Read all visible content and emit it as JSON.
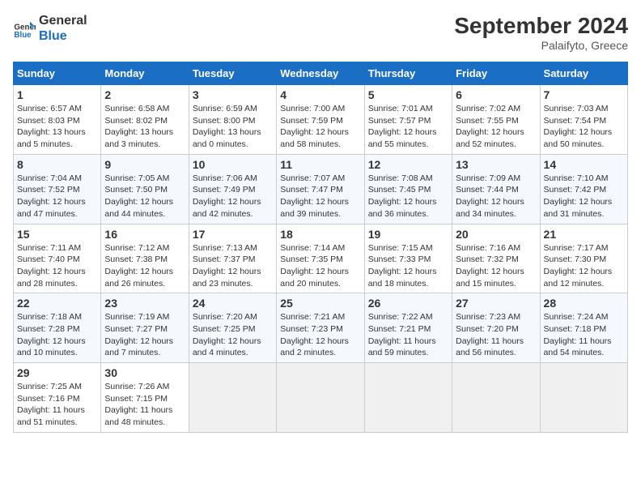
{
  "logo": {
    "line1": "General",
    "line2": "Blue"
  },
  "title": "September 2024",
  "subtitle": "Palaifyto, Greece",
  "headers": [
    "Sunday",
    "Monday",
    "Tuesday",
    "Wednesday",
    "Thursday",
    "Friday",
    "Saturday"
  ],
  "weeks": [
    [
      {
        "day": "1",
        "info": "Sunrise: 6:57 AM\nSunset: 8:03 PM\nDaylight: 13 hours\nand 5 minutes."
      },
      {
        "day": "2",
        "info": "Sunrise: 6:58 AM\nSunset: 8:02 PM\nDaylight: 13 hours\nand 3 minutes."
      },
      {
        "day": "3",
        "info": "Sunrise: 6:59 AM\nSunset: 8:00 PM\nDaylight: 13 hours\nand 0 minutes."
      },
      {
        "day": "4",
        "info": "Sunrise: 7:00 AM\nSunset: 7:59 PM\nDaylight: 12 hours\nand 58 minutes."
      },
      {
        "day": "5",
        "info": "Sunrise: 7:01 AM\nSunset: 7:57 PM\nDaylight: 12 hours\nand 55 minutes."
      },
      {
        "day": "6",
        "info": "Sunrise: 7:02 AM\nSunset: 7:55 PM\nDaylight: 12 hours\nand 52 minutes."
      },
      {
        "day": "7",
        "info": "Sunrise: 7:03 AM\nSunset: 7:54 PM\nDaylight: 12 hours\nand 50 minutes."
      }
    ],
    [
      {
        "day": "8",
        "info": "Sunrise: 7:04 AM\nSunset: 7:52 PM\nDaylight: 12 hours\nand 47 minutes."
      },
      {
        "day": "9",
        "info": "Sunrise: 7:05 AM\nSunset: 7:50 PM\nDaylight: 12 hours\nand 44 minutes."
      },
      {
        "day": "10",
        "info": "Sunrise: 7:06 AM\nSunset: 7:49 PM\nDaylight: 12 hours\nand 42 minutes."
      },
      {
        "day": "11",
        "info": "Sunrise: 7:07 AM\nSunset: 7:47 PM\nDaylight: 12 hours\nand 39 minutes."
      },
      {
        "day": "12",
        "info": "Sunrise: 7:08 AM\nSunset: 7:45 PM\nDaylight: 12 hours\nand 36 minutes."
      },
      {
        "day": "13",
        "info": "Sunrise: 7:09 AM\nSunset: 7:44 PM\nDaylight: 12 hours\nand 34 minutes."
      },
      {
        "day": "14",
        "info": "Sunrise: 7:10 AM\nSunset: 7:42 PM\nDaylight: 12 hours\nand 31 minutes."
      }
    ],
    [
      {
        "day": "15",
        "info": "Sunrise: 7:11 AM\nSunset: 7:40 PM\nDaylight: 12 hours\nand 28 minutes."
      },
      {
        "day": "16",
        "info": "Sunrise: 7:12 AM\nSunset: 7:38 PM\nDaylight: 12 hours\nand 26 minutes."
      },
      {
        "day": "17",
        "info": "Sunrise: 7:13 AM\nSunset: 7:37 PM\nDaylight: 12 hours\nand 23 minutes."
      },
      {
        "day": "18",
        "info": "Sunrise: 7:14 AM\nSunset: 7:35 PM\nDaylight: 12 hours\nand 20 minutes."
      },
      {
        "day": "19",
        "info": "Sunrise: 7:15 AM\nSunset: 7:33 PM\nDaylight: 12 hours\nand 18 minutes."
      },
      {
        "day": "20",
        "info": "Sunrise: 7:16 AM\nSunset: 7:32 PM\nDaylight: 12 hours\nand 15 minutes."
      },
      {
        "day": "21",
        "info": "Sunrise: 7:17 AM\nSunset: 7:30 PM\nDaylight: 12 hours\nand 12 minutes."
      }
    ],
    [
      {
        "day": "22",
        "info": "Sunrise: 7:18 AM\nSunset: 7:28 PM\nDaylight: 12 hours\nand 10 minutes."
      },
      {
        "day": "23",
        "info": "Sunrise: 7:19 AM\nSunset: 7:27 PM\nDaylight: 12 hours\nand 7 minutes."
      },
      {
        "day": "24",
        "info": "Sunrise: 7:20 AM\nSunset: 7:25 PM\nDaylight: 12 hours\nand 4 minutes."
      },
      {
        "day": "25",
        "info": "Sunrise: 7:21 AM\nSunset: 7:23 PM\nDaylight: 12 hours\nand 2 minutes."
      },
      {
        "day": "26",
        "info": "Sunrise: 7:22 AM\nSunset: 7:21 PM\nDaylight: 11 hours\nand 59 minutes."
      },
      {
        "day": "27",
        "info": "Sunrise: 7:23 AM\nSunset: 7:20 PM\nDaylight: 11 hours\nand 56 minutes."
      },
      {
        "day": "28",
        "info": "Sunrise: 7:24 AM\nSunset: 7:18 PM\nDaylight: 11 hours\nand 54 minutes."
      }
    ],
    [
      {
        "day": "29",
        "info": "Sunrise: 7:25 AM\nSunset: 7:16 PM\nDaylight: 11 hours\nand 51 minutes."
      },
      {
        "day": "30",
        "info": "Sunrise: 7:26 AM\nSunset: 7:15 PM\nDaylight: 11 hours\nand 48 minutes."
      },
      null,
      null,
      null,
      null,
      null
    ]
  ]
}
